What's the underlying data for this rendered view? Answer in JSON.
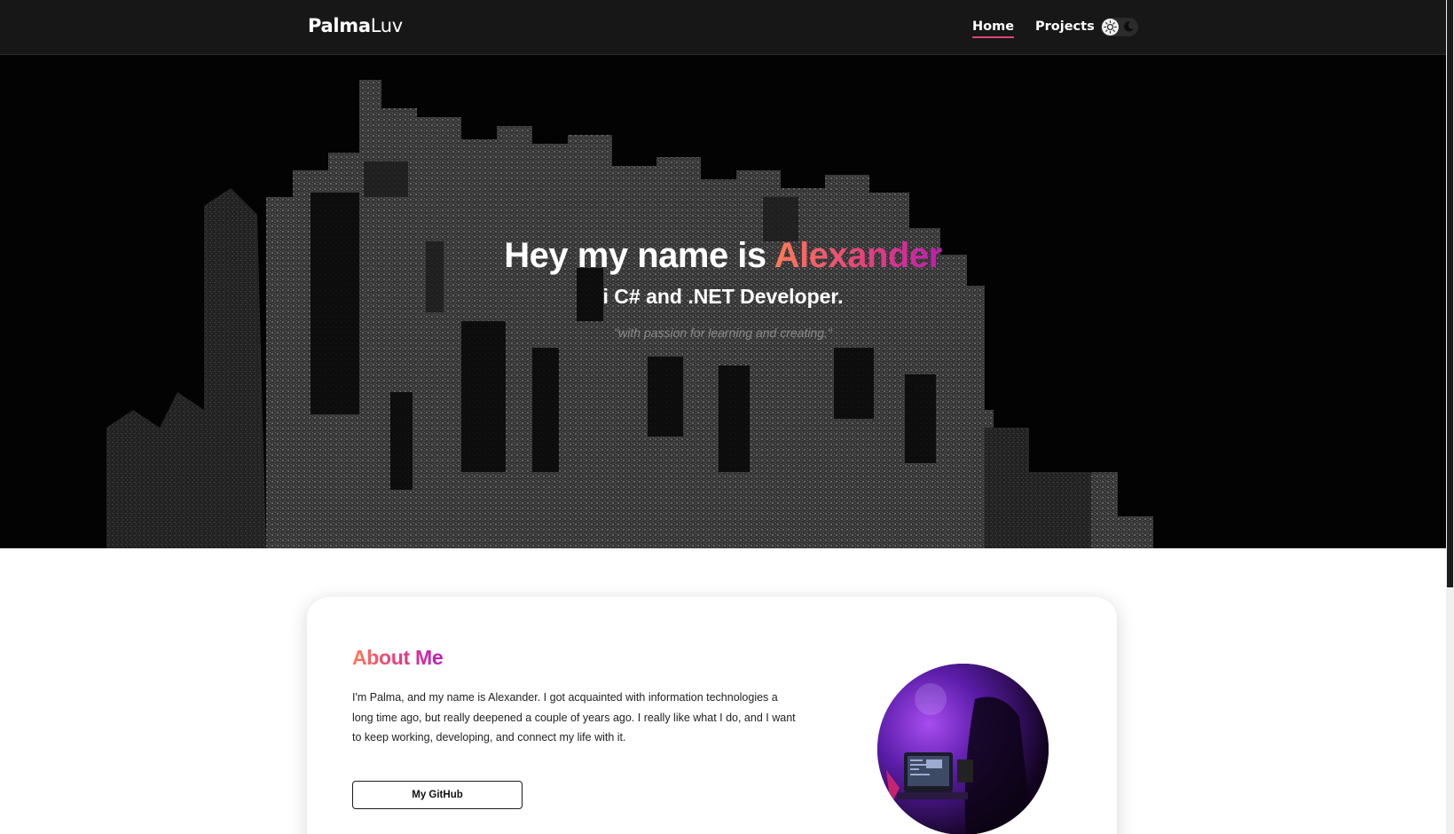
{
  "nav": {
    "brand_bold": "Palma",
    "brand_light": "Luv",
    "links": [
      {
        "label": "Home",
        "active": true
      },
      {
        "label": "Projects",
        "active": false
      }
    ],
    "theme_toggle": {
      "left_icon": "sun-icon",
      "right_icon": "moon-icon",
      "selected": "light"
    }
  },
  "hero": {
    "title_prefix": "Hey my name is ",
    "title_name": "Alexander",
    "subtitle": "i C# and .NET Developer.",
    "quote": "\"with passion for learning and creating.\"",
    "background": "dark-ascii-cityscape"
  },
  "about": {
    "title": "About Me",
    "text": "I'm Palma, and my name is Alexander. I got acquainted with information technologies a long time ago, but really deepened a couple of years ago. I really like what I do, and I want to keep working, developing, and connect my life with it.",
    "button_label": "My GitHub",
    "avatar": "profile-photo-purple-lit-desk"
  },
  "colors": {
    "navbar_bg": "#171717",
    "accent_start": "#ff7a59",
    "accent_mid": "#e4407c",
    "accent_end": "#c21ab4",
    "hero_bg": "#030303"
  }
}
